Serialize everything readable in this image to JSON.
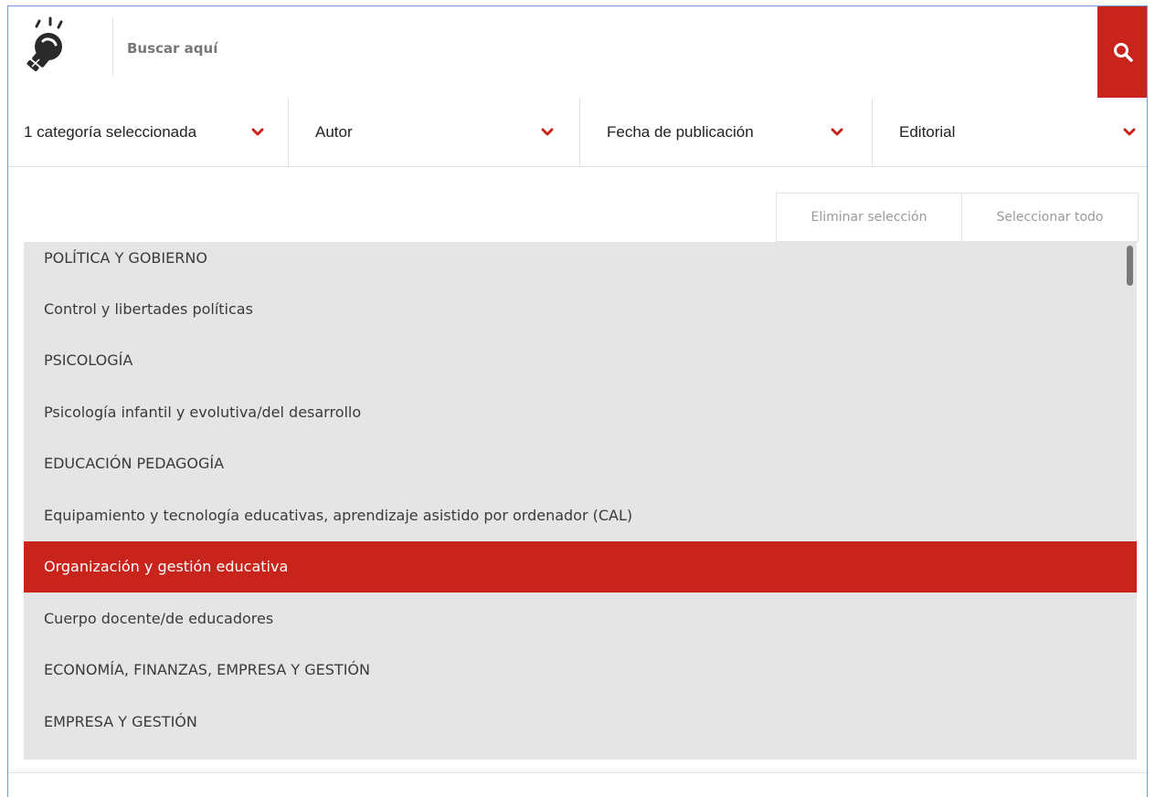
{
  "search": {
    "placeholder": "Buscar aquí"
  },
  "colors": {
    "accent": "#c8241c",
    "list_background": "#e5e5e5"
  },
  "icons": {
    "logo": "idea-bulb-logo-icon",
    "search": "search-icon",
    "dropdown": "chevron-down-icon"
  },
  "filters": [
    {
      "label": "1 categoría seleccionada"
    },
    {
      "label": "Autor"
    },
    {
      "label": "Fecha de publicación"
    },
    {
      "label": "Editorial"
    }
  ],
  "actions": {
    "clear_label": "Eliminar selección",
    "select_all_label": "Seleccionar todo"
  },
  "categories": [
    {
      "label": "POLÍTICA Y GOBIERNO",
      "selected": false
    },
    {
      "label": "Control y libertades políticas",
      "selected": false
    },
    {
      "label": "PSICOLOGÍA",
      "selected": false
    },
    {
      "label": "Psicología infantil y evolutiva/del desarrollo",
      "selected": false
    },
    {
      "label": "EDUCACIÓN PEDAGOGÍA",
      "selected": false
    },
    {
      "label": "Equipamiento y tecnología educativas, aprendizaje asistido por ordenador (CAL)",
      "selected": false
    },
    {
      "label": "Organización y gestión educativa",
      "selected": true
    },
    {
      "label": "Cuerpo docente/de educadores",
      "selected": false
    },
    {
      "label": "ECONOMÍA, FINANZAS, EMPRESA Y GESTIÓN",
      "selected": false
    },
    {
      "label": "EMPRESA Y GESTIÓN",
      "selected": false
    }
  ]
}
